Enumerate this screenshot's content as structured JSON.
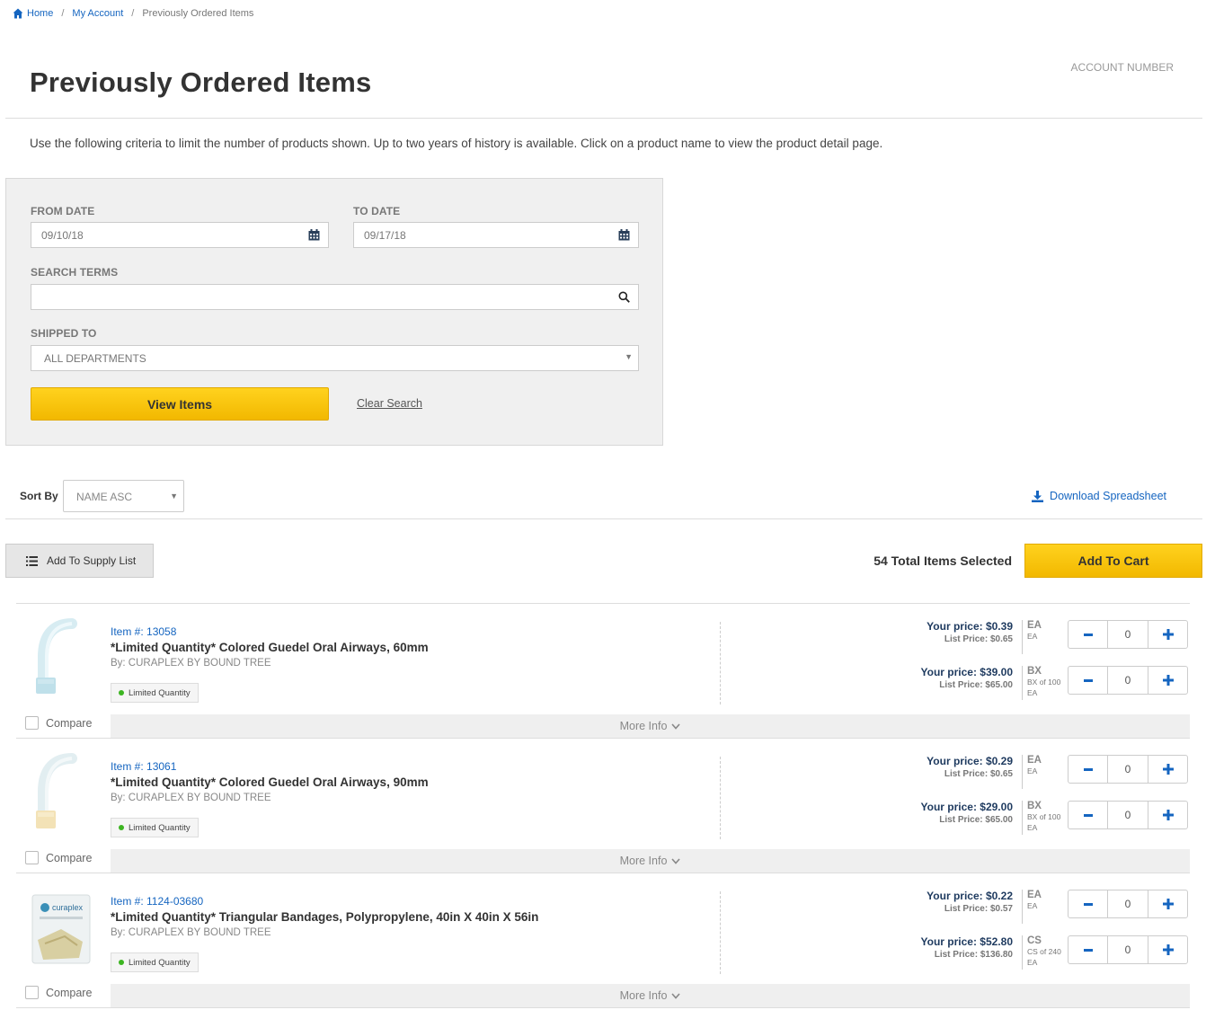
{
  "breadcrumb": {
    "home": "Home",
    "account": "My Account",
    "current": "Previously Ordered Items"
  },
  "page": {
    "title": "Previously Ordered Items",
    "account_number_label": "ACCOUNT NUMBER",
    "intro": "Use the following criteria to limit the number of products shown. Up to two years of history is available. Click on a product name to view the product detail page."
  },
  "filters": {
    "from_date_label": "FROM DATE",
    "from_date_value": "09/10/18",
    "to_date_label": "TO DATE",
    "to_date_value": "09/17/18",
    "search_label": "SEARCH TERMS",
    "search_value": "",
    "shipped_label": "SHIPPED TO",
    "shipped_value": "ALL DEPARTMENTS",
    "view_button": "View Items",
    "clear_link": "Clear Search"
  },
  "sort": {
    "label": "Sort By",
    "value": "NAME ASC"
  },
  "download_label": "Download Spreadsheet",
  "actions": {
    "supply_list_label": "Add To Supply List",
    "total_selected": "54 Total Items Selected",
    "add_to_cart_label": "Add To Cart"
  },
  "colors": {
    "accent": "#1565c0",
    "button_yellow": "#f7c600",
    "badge_dot": "#3cb521"
  },
  "products": [
    {
      "item_no": "Item #: 13058",
      "name": "*Limited Quantity* Colored Guedel Oral Airways, 60mm",
      "by": "By: CURAPLEX BY BOUND TREE",
      "badge": "Limited Quantity",
      "compare": "Compare",
      "more_info": "More Info",
      "image_icon": "oral-airway-icon",
      "prices": [
        {
          "your_price": "Your price: $0.39",
          "list_price": "List Price: $0.65",
          "uom": "EA",
          "uom_desc": "EA",
          "uom_desc2": "",
          "qty": "0"
        },
        {
          "your_price": "Your price: $39.00",
          "list_price": "List Price: $65.00",
          "uom": "BX",
          "uom_desc": "BX of 100",
          "uom_desc2": "EA",
          "qty": "0"
        }
      ]
    },
    {
      "item_no": "Item #: 13061",
      "name": "*Limited Quantity* Colored Guedel Oral Airways, 90mm",
      "by": "By: CURAPLEX BY BOUND TREE",
      "badge": "Limited Quantity",
      "compare": "Compare",
      "more_info": "More Info",
      "image_icon": "oral-airway-icon",
      "prices": [
        {
          "your_price": "Your price: $0.29",
          "list_price": "List Price: $0.65",
          "uom": "EA",
          "uom_desc": "EA",
          "uom_desc2": "",
          "qty": "0"
        },
        {
          "your_price": "Your price: $29.00",
          "list_price": "List Price: $65.00",
          "uom": "BX",
          "uom_desc": "BX of 100",
          "uom_desc2": "EA",
          "qty": "0"
        }
      ]
    },
    {
      "item_no": "Item #: 1124-03680",
      "name": "*Limited Quantity* Triangular Bandages, Polypropylene, 40in X 40in X 56in",
      "by": "By: CURAPLEX BY BOUND TREE",
      "badge": "Limited Quantity",
      "compare": "Compare",
      "more_info": "More Info",
      "image_icon": "bandage-package-icon",
      "prices": [
        {
          "your_price": "Your price: $0.22",
          "list_price": "List Price: $0.57",
          "uom": "EA",
          "uom_desc": "EA",
          "uom_desc2": "",
          "qty": "0"
        },
        {
          "your_price": "Your price: $52.80",
          "list_price": "List Price: $136.80",
          "uom": "CS",
          "uom_desc": "CS of 240",
          "uom_desc2": "EA",
          "qty": "0"
        }
      ]
    }
  ]
}
